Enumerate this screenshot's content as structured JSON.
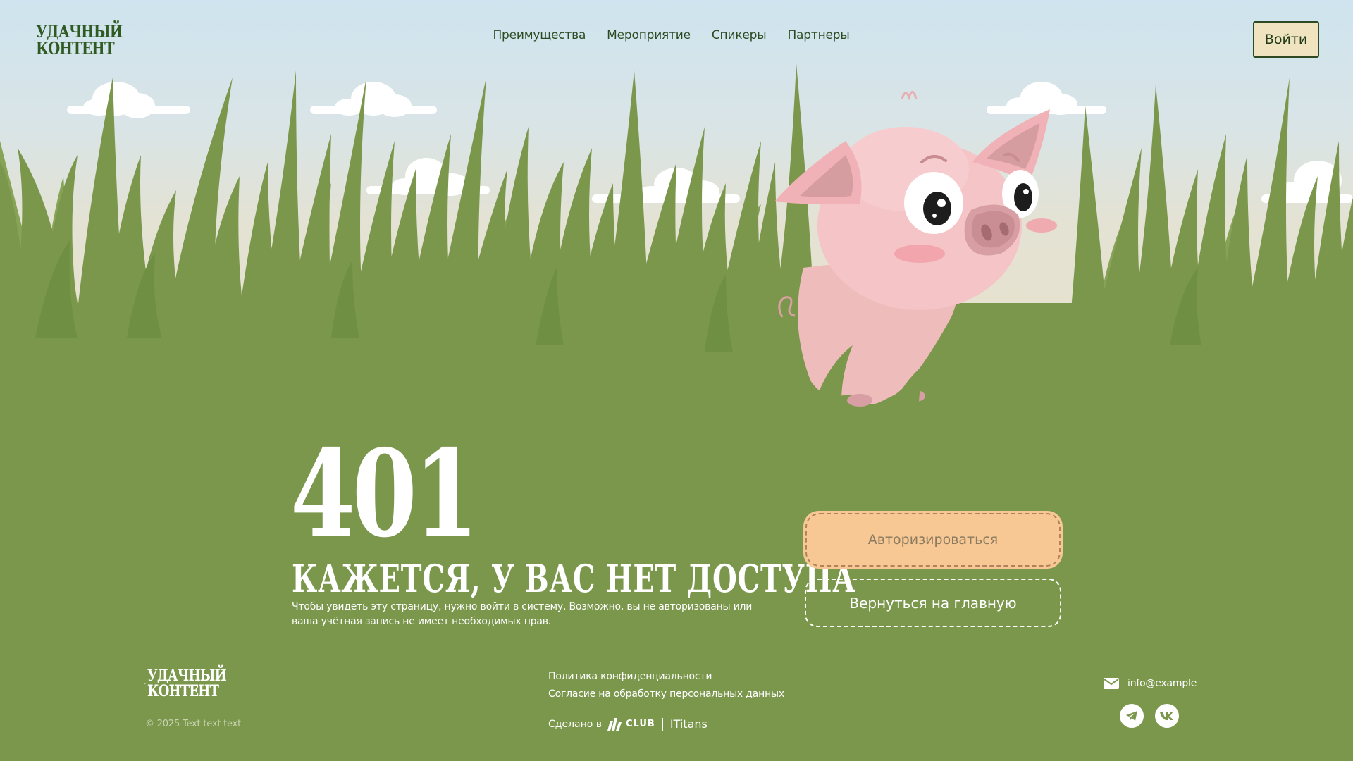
{
  "header": {
    "logo_line1": "УДАЧНЫЙ",
    "logo_line2": "КОНТЕНТ",
    "nav": [
      "Преимущества",
      "Мероприятие",
      "Спикеры",
      "Партнеры"
    ],
    "login_label": "Войти"
  },
  "error": {
    "code": "401",
    "headline": "КАЖЕТСЯ, У ВАС НЕТ ДОСТУПА",
    "description": "Чтобы увидеть эту страницу, нужно войти в систему. Возможно, вы не авторизованы или ваша учётная запись не имеет необходимых прав.",
    "primary_button": "Авторизироваться",
    "secondary_button": "Вернуться на главную"
  },
  "footer": {
    "logo_line1": "УДАЧНЫЙ",
    "logo_line2": "КОНТЕНТ",
    "copyright": "© 2025 Text text text",
    "links": [
      "Политика конфиденциальности",
      "Согласие на обработку персональных данных"
    ],
    "made_in_label": "Сделано в",
    "club_label": "CLUB",
    "studio": "ITitans",
    "email": "info@example",
    "socials": [
      "telegram-icon",
      "vk-icon"
    ]
  },
  "colors": {
    "grass": "#7a974c",
    "grass_dark": "#6f8f42",
    "accent_button": "#f7c894",
    "login_bg": "#efe3c0",
    "logo_green": "#2f5a22",
    "pig_pink": "#f5bcc0"
  }
}
